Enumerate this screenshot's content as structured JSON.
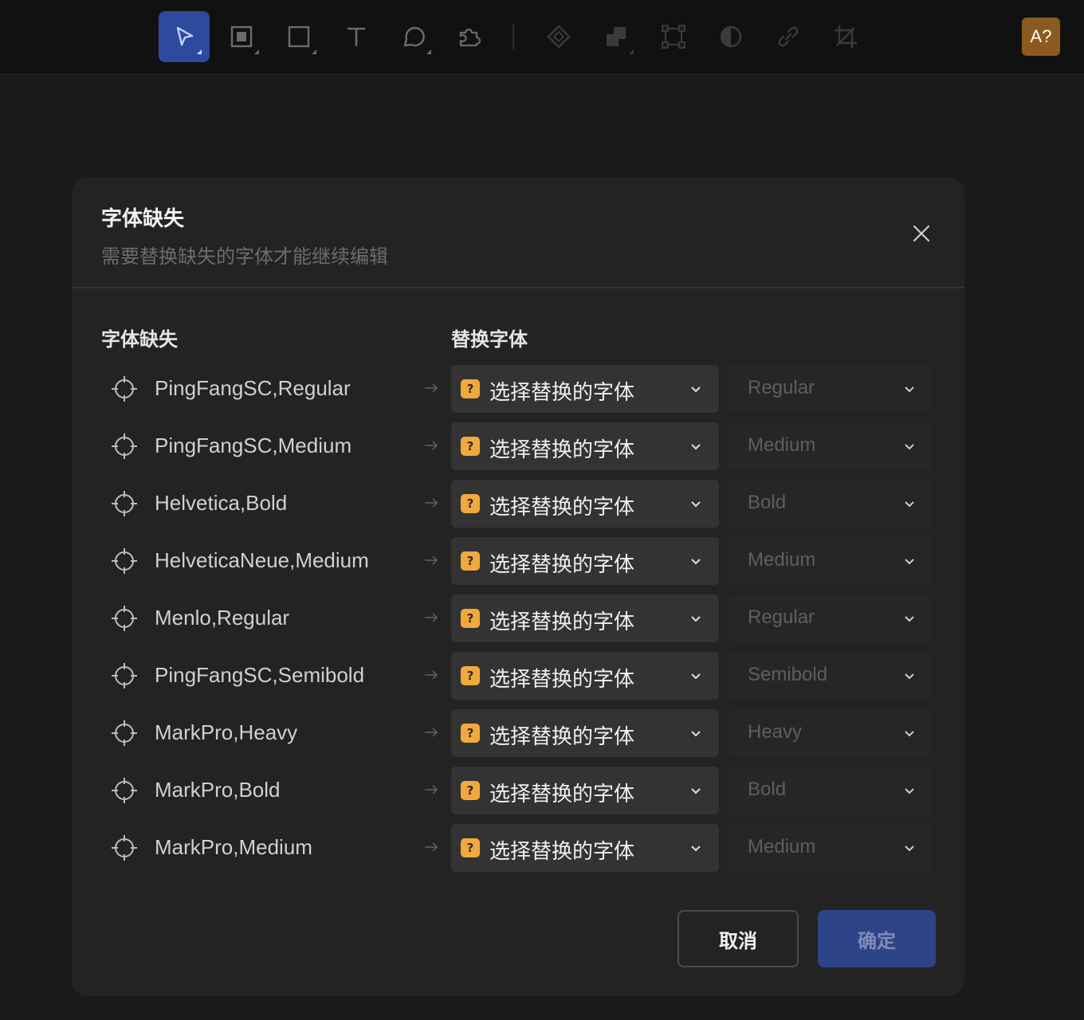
{
  "toolbar": {
    "tools": [
      {
        "name": "select-tool",
        "icon": "cursor-arrow-icon",
        "active": true
      },
      {
        "name": "frame-tool",
        "icon": "frame-icon"
      },
      {
        "name": "rectangle-tool",
        "icon": "rectangle-icon"
      },
      {
        "name": "text-tool",
        "icon": "text-t-icon"
      },
      {
        "name": "comment-tool",
        "icon": "speech-bubble-icon"
      },
      {
        "name": "plugin-tool",
        "icon": "puzzle-piece-icon"
      },
      {
        "name": "component-tool",
        "icon": "diamond-icon"
      },
      {
        "name": "boolean-tool",
        "icon": "boolean-shapes-icon"
      },
      {
        "name": "transform-tool",
        "icon": "bounding-box-icon"
      },
      {
        "name": "mask-tool",
        "icon": "half-circle-icon"
      },
      {
        "name": "link-tool",
        "icon": "link-icon"
      },
      {
        "name": "crop-tool",
        "icon": "crop-icon"
      }
    ],
    "avatar_text": "A?",
    "avatar_color": "#8a5a1e",
    "accent_color": "#2d4a9e"
  },
  "dialog": {
    "title": "字体缺失",
    "subtitle": "需要替换缺失的字体才能继续编辑",
    "col_missing": "字体缺失",
    "col_replace": "替换字体",
    "rows": [
      {
        "font": "PingFangSC,Regular",
        "replace": "选择替换的字体",
        "weight": "Regular"
      },
      {
        "font": "PingFangSC,Medium",
        "replace": "选择替换的字体",
        "weight": "Medium"
      },
      {
        "font": "Helvetica,Bold",
        "replace": "选择替换的字体",
        "weight": "Bold"
      },
      {
        "font": "HelveticaNeue,Medium",
        "replace": "选择替换的字体",
        "weight": "Medium"
      },
      {
        "font": "Menlo,Regular",
        "replace": "选择替换的字体",
        "weight": "Regular"
      },
      {
        "font": "PingFangSC,Semibold",
        "replace": "选择替换的字体",
        "weight": "Semibold"
      },
      {
        "font": "MarkPro,Heavy",
        "replace": "选择替换的字体",
        "weight": "Heavy"
      },
      {
        "font": "MarkPro,Bold",
        "replace": "选择替换的字体",
        "weight": "Bold"
      },
      {
        "font": "MarkPro,Medium",
        "replace": "选择替换的字体",
        "weight": "Medium"
      }
    ],
    "warn_glyph": "?",
    "warn_color": "#f2a93b",
    "cancel_label": "取消",
    "ok_label": "确定"
  }
}
